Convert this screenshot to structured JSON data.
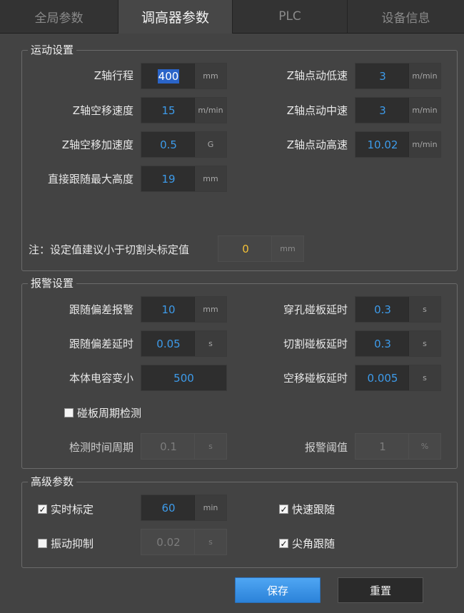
{
  "tabs": [
    "全局参数",
    "调高器参数",
    "PLC",
    "设备信息"
  ],
  "motion": {
    "legend": "运动设置",
    "z_travel": {
      "label": "Z轴行程",
      "value": "400",
      "unit": "mm"
    },
    "z_move_speed": {
      "label": "Z轴空移速度",
      "value": "15",
      "unit": "m/min"
    },
    "z_move_accel": {
      "label": "Z轴空移加速度",
      "value": "0.5",
      "unit": "G"
    },
    "max_follow_h": {
      "label": "直接跟随最大高度",
      "value": "19",
      "unit": "mm"
    },
    "jog_low": {
      "label": "Z轴点动低速",
      "value": "3",
      "unit": "m/min"
    },
    "jog_mid": {
      "label": "Z轴点动中速",
      "value": "3",
      "unit": "m/min"
    },
    "jog_high": {
      "label": "Z轴点动高速",
      "value": "10.02",
      "unit": "m/min"
    },
    "note": {
      "label": "注：设定值建议小于切割头标定值",
      "value": "0",
      "unit": "mm"
    }
  },
  "alarm": {
    "legend": "报警设置",
    "follow_dev_alarm": {
      "label": "跟随偏差报警",
      "value": "10",
      "unit": "mm"
    },
    "follow_dev_delay": {
      "label": "跟随偏差延时",
      "value": "0.05",
      "unit": "s"
    },
    "cap_change": {
      "label": "本体电容变小",
      "value": "500"
    },
    "pierce_delay": {
      "label": "穿孔碰板延时",
      "value": "0.3",
      "unit": "s"
    },
    "cut_delay": {
      "label": "切割碰板延时",
      "value": "0.3",
      "unit": "s"
    },
    "move_delay": {
      "label": "空移碰板延时",
      "value": "0.005",
      "unit": "s"
    },
    "periodic_check": {
      "label": "碰板周期检测",
      "checked": false
    },
    "check_period": {
      "label": "检测时间周期",
      "value": "0.1",
      "unit": "s"
    },
    "alarm_threshold": {
      "label": "报警阈值",
      "value": "1",
      "unit": "%"
    }
  },
  "advanced": {
    "legend": "高级参数",
    "realtime_calib": {
      "label": "实时标定",
      "checked": true,
      "value": "60",
      "unit": "min"
    },
    "vibration": {
      "label": "振动抑制",
      "checked": false,
      "value": "0.02",
      "unit": "s"
    },
    "fast_follow": {
      "label": "快速跟随",
      "checked": true
    },
    "corner_follow": {
      "label": "尖角跟随",
      "checked": true
    }
  },
  "buttons": {
    "save": "保存",
    "reset": "重置"
  },
  "colors": {
    "value_blue": "#3d9bea",
    "note_yellow": "#f2c037",
    "save_blue": "#3b94e8"
  }
}
